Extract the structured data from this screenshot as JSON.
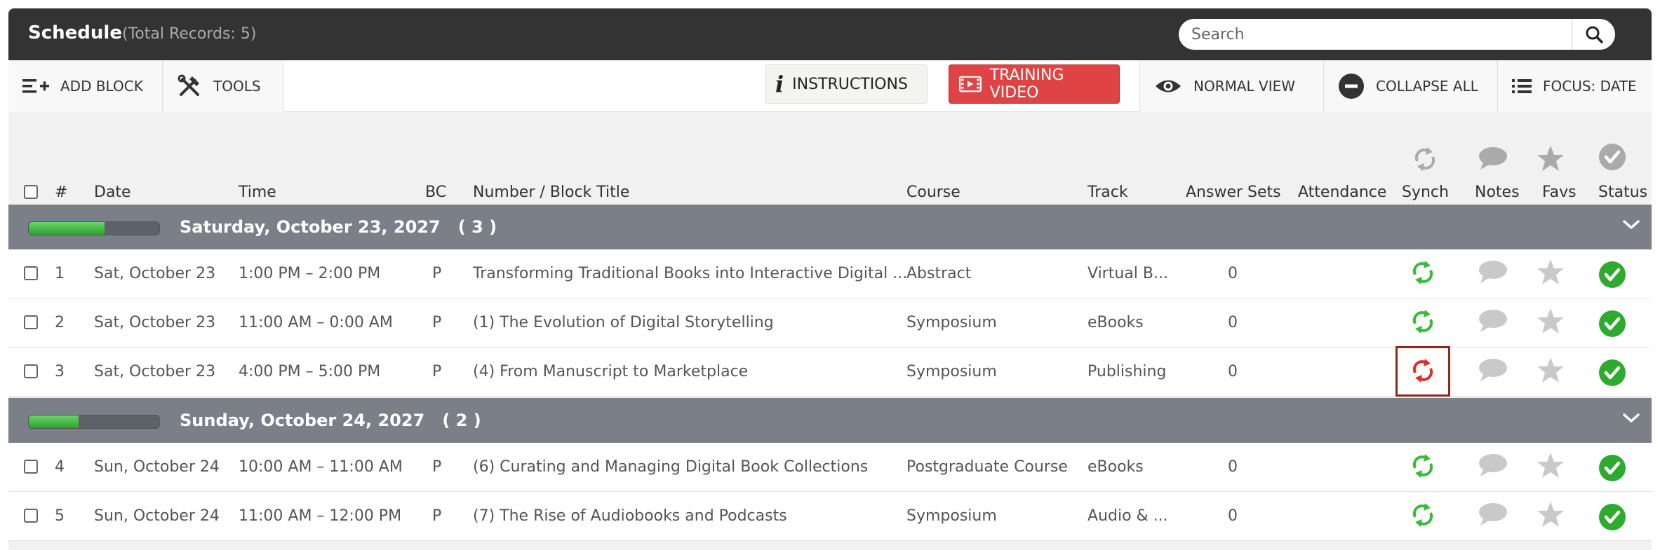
{
  "header": {
    "title": "Schedule",
    "record_count": "(Total Records: 5)",
    "search_placeholder": "Search"
  },
  "toolbar": {
    "add_block": "ADD BLOCK",
    "tools": "TOOLS",
    "instructions": "INSTRUCTIONS",
    "training_video": "TRAINING VIDEO",
    "normal_view": "NORMAL VIEW",
    "collapse_all": "COLLAPSE ALL",
    "focus_date": "FOCUS: DATE"
  },
  "columns": {
    "num": "#",
    "date": "Date",
    "time": "Time",
    "bc": "BC",
    "title": "Number / Block Title",
    "course": "Course",
    "track": "Track",
    "answer_sets": "Answer Sets",
    "attendance": "Attendance",
    "synch": "Synch",
    "notes": "Notes",
    "favs": "Favs",
    "status": "Status"
  },
  "groups": [
    {
      "label": "Saturday, October 23, 2027",
      "count": "( 3 )",
      "progress": 0.58,
      "rows": [
        {
          "num": "1",
          "date": "Sat, October 23",
          "time": "1:00 PM – 2:00 PM",
          "bc": "P",
          "title": "Transforming Traditional Books into Interactive Digital ...",
          "course": "Abstract",
          "track": "Virtual B...",
          "answer_sets": "0",
          "synch_state": "ok"
        },
        {
          "num": "2",
          "date": "Sat, October 23",
          "time": "11:00 AM – 0:00 AM",
          "bc": "P",
          "title": "(1) The Evolution of Digital Storytelling",
          "course": "Symposium",
          "track": "eBooks",
          "answer_sets": "0",
          "synch_state": "ok"
        },
        {
          "num": "3",
          "date": "Sat, October 23",
          "time": "4:00 PM – 5:00 PM",
          "bc": "P",
          "title": "(4) From Manuscript to Marketplace",
          "course": "Symposium",
          "track": "Publishing",
          "answer_sets": "0",
          "synch_state": "error"
        }
      ]
    },
    {
      "label": "Sunday, October 24, 2027",
      "count": "( 2 )",
      "progress": 0.38,
      "rows": [
        {
          "num": "4",
          "date": "Sun, October 24",
          "time": "10:00 AM – 11:00 AM",
          "bc": "P",
          "title": "(6) Curating and Managing Digital Book Collections",
          "course": "Postgraduate Course",
          "track": "eBooks",
          "answer_sets": "0",
          "synch_state": "ok"
        },
        {
          "num": "5",
          "date": "Sun, October 24",
          "time": "11:00 AM – 12:00 PM",
          "bc": "P",
          "title": "(7) The Rise of Audiobooks and Podcasts",
          "course": "Symposium",
          "track": "Audio & ...",
          "answer_sets": "0",
          "synch_state": "ok"
        }
      ]
    }
  ],
  "colors": {
    "header_bg": "#333333",
    "group_bg": "#7b8088",
    "synch_ok": "#3cb93c",
    "synch_error": "#d9302c",
    "status_ok": "#2eaa2e",
    "training_video_bg": "#e04343"
  },
  "icons": {
    "search": "search-icon",
    "add_block": "add-list-icon",
    "tools": "tools-icon",
    "instructions": "info-icon",
    "training_video": "video-icon",
    "normal_view": "eye-icon",
    "collapse_all": "minus-circle-icon",
    "focus_date": "list-icon",
    "synch": "sync-icon",
    "notes": "comment-icon",
    "favs": "star-icon",
    "status": "check-circle-icon",
    "group_toggle": "chevron-down-icon"
  }
}
